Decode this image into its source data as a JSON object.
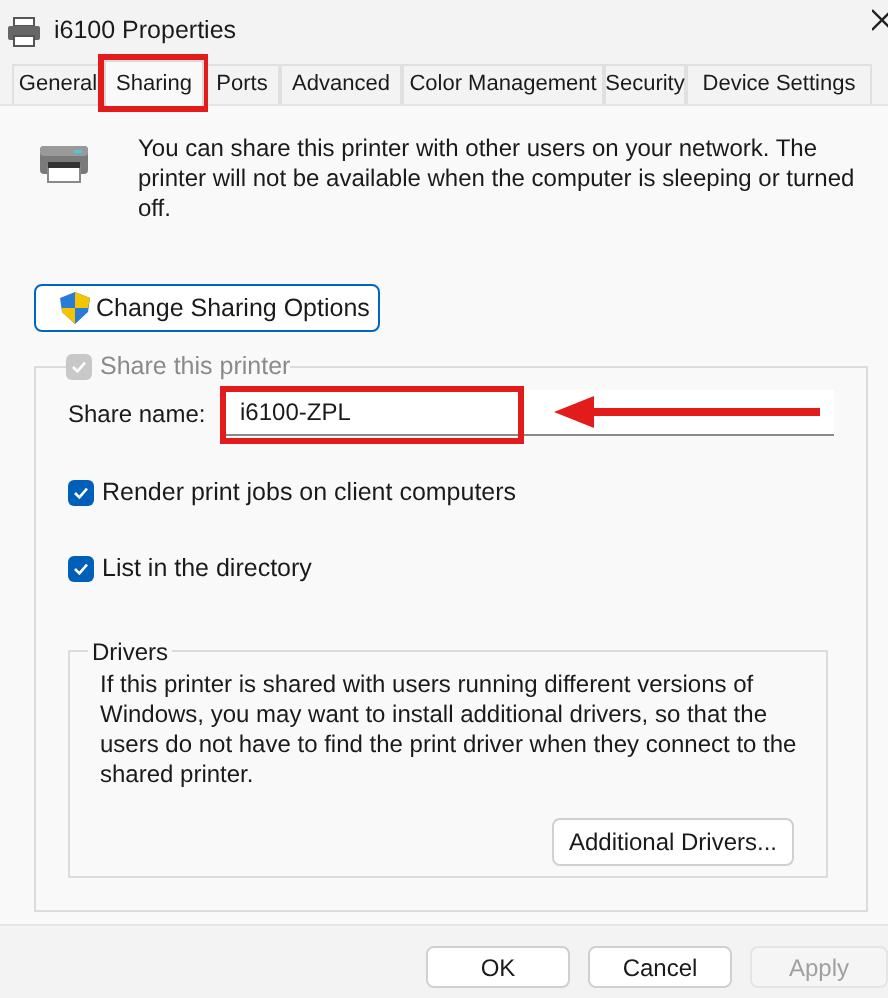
{
  "window": {
    "title": "i6100 Properties"
  },
  "tabs": [
    {
      "label": "General",
      "selected": false
    },
    {
      "label": "Sharing",
      "selected": true
    },
    {
      "label": "Ports",
      "selected": false
    },
    {
      "label": "Advanced",
      "selected": false
    },
    {
      "label": "Color Management",
      "selected": false
    },
    {
      "label": "Security",
      "selected": false
    },
    {
      "label": "Device Settings",
      "selected": false
    }
  ],
  "description": "You can share this printer with other users on your network. The printer will not be available when the computer is sleeping or turned off.",
  "change_sharing_button": "Change Sharing Options",
  "share_this_printer": {
    "label": "Share this printer",
    "checked": true,
    "disabled": true
  },
  "share_name": {
    "label": "Share name:",
    "value": "i6100-ZPL"
  },
  "options": [
    {
      "label": "Render print jobs on client computers",
      "checked": true
    },
    {
      "label": "List in the directory",
      "checked": true
    }
  ],
  "drivers": {
    "title": "Drivers",
    "text": "If this printer is shared with users running different versions of Windows, you may want to install additional drivers, so that the users do not have to find the print driver when they connect to the shared printer.",
    "button": "Additional Drivers..."
  },
  "buttons": [
    {
      "label": "OK",
      "disabled": false
    },
    {
      "label": "Cancel",
      "disabled": false
    },
    {
      "label": "Apply",
      "disabled": true
    }
  ]
}
